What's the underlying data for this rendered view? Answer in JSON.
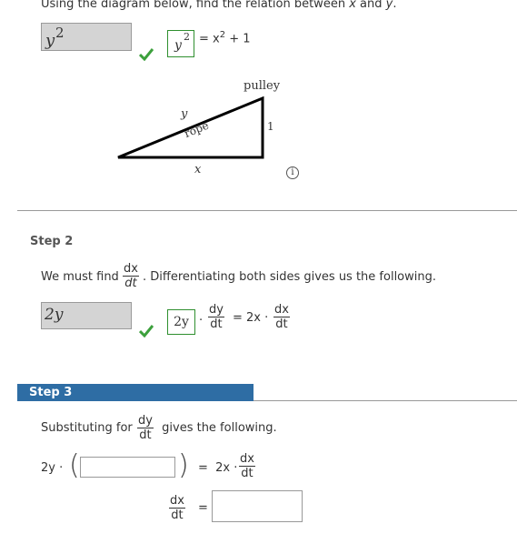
{
  "step1": {
    "instruction_text": "Using the diagram below, find the relation between ",
    "var_x": "x",
    "and_text": " and ",
    "var_y": "y",
    "period": ".",
    "answer_value": "y",
    "answer_exp": "2",
    "shown_base": "y",
    "shown_exp": "2",
    "equation_rest_a": "= x",
    "equation_rest_exp": "2",
    "equation_rest_b": " + 1",
    "diagram": {
      "label_pulley": "pulley",
      "label_y": "y",
      "label_rope": "rope",
      "label_one": "1",
      "label_x": "x"
    },
    "info_icon": "i"
  },
  "step2": {
    "label": "Step 2",
    "sentence_start": "We must find ",
    "frac_num": "dx",
    "frac_den": "dt",
    "sentence_end": ". Differentiating both sides gives us the following.",
    "answer_value": "2y",
    "shown_value": "2y",
    "dot": "·",
    "dy": "dy",
    "dt": "dt",
    "eq_mid": "= 2x ·",
    "dx": "dx",
    "dt2": "dt"
  },
  "step3": {
    "label": "Step 3",
    "sentence_start": "Substituting for ",
    "frac_num": "dy",
    "frac_den": "dt",
    "sentence_end": " gives the following.",
    "lhs": "2y ·",
    "input1_value": "",
    "eq_mid": "=  2x ·",
    "dx": "dx",
    "dt": "dt",
    "final_num": "dx",
    "final_den": "dt",
    "final_eq": "=",
    "input2_value": ""
  },
  "colors": {
    "check": "#3ca03c",
    "step_bar": "#2e6da4",
    "answer_bg": "#d4d4d4",
    "ok_border": "#2f8f2f"
  }
}
